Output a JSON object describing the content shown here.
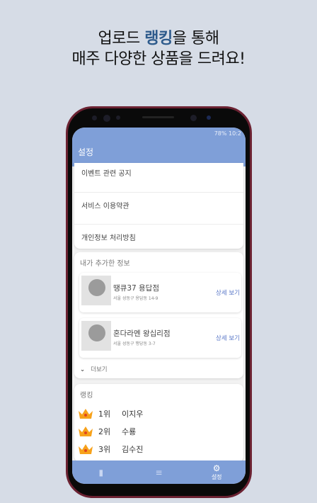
{
  "headline": {
    "line1_pre": "업로드 ",
    "line1_highlight": "랭킹",
    "line1_post": "을 통해",
    "line2": "매주 다양한 상품을 드려요!"
  },
  "status_bar": {
    "text": "78% 10:2"
  },
  "app_bar": {
    "title": "설정"
  },
  "menu": [
    "이벤트 관련 공지",
    "서비스 이용약관",
    "개인정보 처리방침"
  ],
  "my_info": {
    "label": "내가 추가한 정보",
    "places": [
      {
        "name": "땡큐37 용답점",
        "address": "서울 성동구 용답동 14-9",
        "action": "상세 보기"
      },
      {
        "name": "혼다라멘 왕십리점",
        "address": "서울 성동구 행당동 3-7",
        "action": "상세 보기"
      }
    ],
    "more": "더보기"
  },
  "ranking": {
    "label": "랭킹",
    "rows": [
      {
        "rank": "1위",
        "name": "이지우"
      },
      {
        "rank": "2위",
        "name": "수룡"
      },
      {
        "rank": "3위",
        "name": "김수진"
      }
    ]
  },
  "bottom_nav": {
    "settings_label": "설정"
  },
  "colors": {
    "primary": "#7f9fd8",
    "highlight": "#2e5b8c",
    "link": "#5a78c8"
  }
}
